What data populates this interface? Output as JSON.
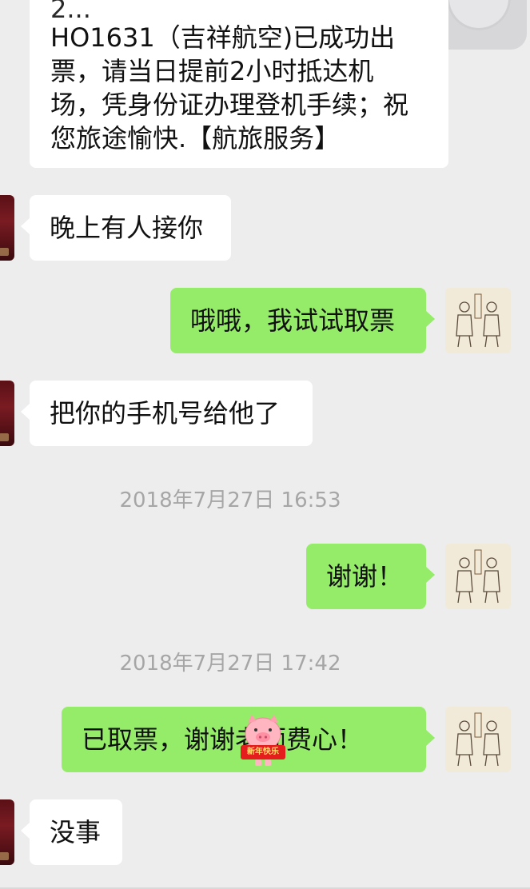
{
  "messages": {
    "m1_line_top": "2...",
    "m1_line1": "HO1631（吉祥航空)已成功出",
    "m1_line2": "票，请当日提前2小时抵达机",
    "m1_line3": "场，凭身份证办理登机手续；祝",
    "m1_line4": "您旅途愉快.【航旅服务】",
    "m2": "晚上有人接你",
    "m3": "哦哦，我试试取票",
    "m4": "把你的手机号给他了",
    "m5": "谢谢！",
    "m6": "已取票，谢谢老师费心！",
    "m7": "没事"
  },
  "timestamps": {
    "t1": "2018年7月27日 16:53",
    "t2": "2018年7月27日 17:42"
  },
  "sticker": {
    "text": "新年快乐",
    "name": "pig-sticker"
  },
  "colors": {
    "background": "#ededed",
    "incoming_bubble": "#ffffff",
    "outgoing_bubble": "#95ec69",
    "timestamp_text": "#a6a6a6"
  }
}
